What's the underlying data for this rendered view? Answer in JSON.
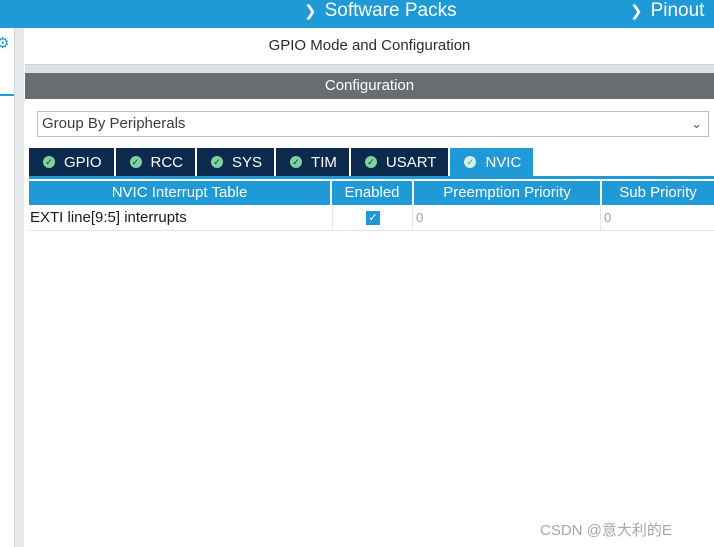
{
  "topbar": {
    "software_packs": "Software Packs",
    "pinout": "Pinout"
  },
  "panel": {
    "title": "GPIO Mode and Configuration",
    "config_header": "Configuration"
  },
  "group_select": {
    "value": "Group By Peripherals"
  },
  "tabs": [
    {
      "label": "GPIO"
    },
    {
      "label": "RCC"
    },
    {
      "label": "SYS"
    },
    {
      "label": "TIM"
    },
    {
      "label": "USART"
    },
    {
      "label": "NVIC",
      "active": true
    }
  ],
  "table": {
    "columns": [
      "NVIC Interrupt Table",
      "Enabled",
      "Preemption Priority",
      "Sub Priority"
    ],
    "rows": [
      {
        "name": "EXTI line[9:5] interrupts",
        "enabled": true,
        "preemption": "0",
        "sub": "0"
      }
    ]
  },
  "watermark": "CSDN @意大利的E",
  "colors": {
    "accent": "#1f9ad6",
    "tab_dark": "#0b2a4e",
    "header_gray": "#6a6d70"
  }
}
